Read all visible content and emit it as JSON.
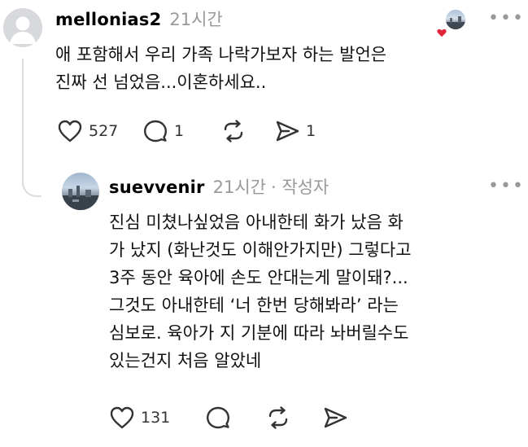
{
  "comment": {
    "username": "mellonias2",
    "time": "21시간",
    "more": "•••",
    "text_lines": [
      "애 포함해서 우리 가족 나락가보자 하는 발언은",
      "진짜 선 넘었음...이혼하세요.."
    ],
    "actions": {
      "like_count": "527",
      "reply_count": "1",
      "share_count": "1"
    }
  },
  "reply": {
    "username": "suevvenir",
    "time": "21시간",
    "author_tag": "· 작성자",
    "more": "•••",
    "text_lines": [
      "진심 미쳤나싶었음 아내한테 화가 났음 화",
      "가 났지 (화난것도 이해안가지만) 그렇다고",
      "3주 동안 육아에 손도 안대는게 말이돼?...",
      "그것도 아내한테 ‘너 한번 당해봐라’ 라는",
      "심보로. 육아가 지 기분에 따라 놔버릴수도",
      "있는건지 처음 알았네"
    ],
    "actions": {
      "like_count": "131"
    }
  },
  "colors": {
    "heart_badge": "#e0243a",
    "meta_gray": "#999999",
    "icon_stroke": "#333333"
  }
}
